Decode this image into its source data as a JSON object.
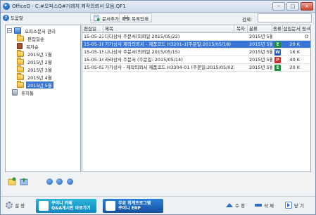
{
  "window": {
    "title": "OfficeQ - C:#오피스Q#거래처 제작의뢰서 모음.QF1",
    "minimize": "−",
    "maximize": "□",
    "close": "×"
  },
  "toolbar": {
    "help_label": "도움말",
    "add_doc_label": "문서추가",
    "print_list_label": "목록인쇄",
    "search_label": "검색:",
    "search_value": ""
  },
  "tree": {
    "root": "오피스문서 관리",
    "items": [
      {
        "label": "편집일순",
        "icon": "folder-icon"
      },
      {
        "label": "목차순",
        "icon": "book-icon"
      },
      {
        "label": "2015년 1월",
        "icon": "folder-icon"
      },
      {
        "label": "2015년 2월",
        "icon": "folder-icon"
      },
      {
        "label": "2015년 3월",
        "icon": "folder-icon"
      },
      {
        "label": "2015년 4월",
        "icon": "folder-icon"
      },
      {
        "label": "2015년 5월",
        "icon": "folder-icon"
      },
      {
        "label": "휴지통",
        "icon": "trash-icon"
      }
    ],
    "selected": "2015년 5월"
  },
  "grid": {
    "headers": [
      "편집일",
      "제목",
      "목차",
      "분류",
      "종류",
      "섭입문서",
      "링크"
    ],
    "rows": [
      {
        "date": "15-05-22",
        "title": "다다상사 주문서(의뢰일 2015/05/22)",
        "toc": "",
        "category": "2015년 5월",
        "kind": "",
        "size": "",
        "link": "O",
        "selected": false
      },
      {
        "date": "15-05-18",
        "title": "가가상사 제작의뢰서 - 제품코드 H3201-1(주문일:2015/05/18)",
        "toc": "",
        "category": "2015년 5월",
        "kind": "E",
        "size": "20 K",
        "link": "",
        "selected": true
      },
      {
        "date": "15-05-15",
        "title": "나나상사 주문서(의뢰일 2015/05/15)",
        "toc": "",
        "category": "2015년 5월",
        "kind": "W",
        "size": "16 K",
        "link": "",
        "selected": false
      },
      {
        "date": "15-05-14",
        "title": "라라상사 주문서 (주문일: 2015/05/14)",
        "toc": "",
        "category": "2015년 5월",
        "kind": "P",
        "size": "40 K",
        "link": "",
        "selected": false
      },
      {
        "date": "15-05-02",
        "title": "가가상사 - 제작의뢰서 제품코드 H3304-01 (주문일:2015/05/02)",
        "toc": "",
        "category": "2015년 5월",
        "kind": "E",
        "size": "20 K",
        "link": "",
        "selected": false
      }
    ],
    "kind_colors": {
      "E": "#1e8a3c",
      "W": "#2a5bb8",
      "P": "#c9322a"
    }
  },
  "bottom": {
    "settings_label": "설 정",
    "banner1_line1": "쿠이니 카페",
    "banner1_line2": "Q&A게시판 바로가기",
    "banner2_line1": "무료 회계프로그램",
    "banner2_line2": "쿠이니 ERP",
    "edit_label": "수 정",
    "delete_label": "삭 제",
    "close_label": "닫 기"
  }
}
